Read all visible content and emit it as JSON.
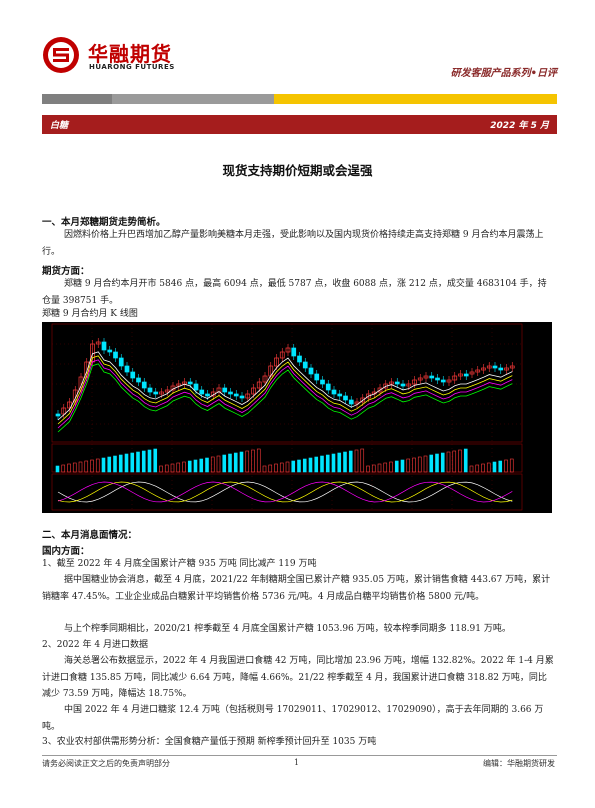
{
  "header": {
    "brand_cn": "华融期货",
    "brand_en": "HUARONG FUTURES",
    "series": "研发客服产品系列•日评",
    "category": "白糖",
    "date": "2022 年 5 月"
  },
  "title": "现货支持期价短期或会逞强",
  "section1": {
    "heading": "一、本月郑糖期货走势简析。",
    "paragraph": "因燃料价格上升巴西增加乙醇产量影响美糖本月走强，受此影响以及国内现货价格持续走高支持郑糖 9 月合约本月震荡上行。",
    "sub_heading": "期货方面：",
    "futures_text": "郑糖 9 月合约本月开市 5846 点，最高 6094 点，最低 5787 点，收盘 6088 点，涨 212 点，成交量 4683104 手，持仓量 398751 手。",
    "chart_caption": "郑糖 9 月合约月 K 线图"
  },
  "section2": {
    "heading": "二、本月消息面情况：",
    "sub_heading": "国内方面：",
    "item1_title": "1、截至 2022 年 4 月底全国累计产糖 935 万吨 同比减产 119 万吨",
    "item1_p1": "据中国糖业协会消息，截至 4 月底，2021/22 年制糖期全国已累计产糖 935.05 万吨，累计销售食糖 443.67 万吨，累计销糖率 47.45%。工业企业成品白糖累计平均销售价格 5736 元/吨。4 月成品白糖平均销售价格 5800 元/吨。",
    "item1_p2": "与上个榨季同期相比，2020/21 榨季截至 4 月底全国累计产糖 1053.96 万吨，较本榨季同期多 118.91 万吨。",
    "item2_title": "2、2022 年 4 月进口数据",
    "item2_p1": "海关总署公布数据显示，2022 年 4 月我国进口食糖 42 万吨，同比增加 23.96 万吨，增幅 132.82%。2022 年 1-4 月累计进口食糖 135.85 万吨，同比减少 6.64 万吨，降幅 4.66%。21/22 榨季截至 4 月，我国累计进口食糖 318.82 万吨，同比减少 73.59 万吨，降幅达 18.75%。",
    "item2_p2": "中国 2022 年 4 月进口糖浆 12.4 万吨（包括税则号 17029011、17029012、17029090），高于去年同期的 3.66 万吨。",
    "item3_title": "3、农业农村部供需形势分析：全国食糖产量低于预期 新榨季预计回升至 1035 万吨"
  },
  "footer": {
    "left": "请务必阅读正文之后的免责声明部分",
    "page": "1",
    "right": "编辑：华融期货研发"
  },
  "colors": {
    "brand_red": "#a51d1d",
    "accent_yellow": "#f5c400"
  }
}
